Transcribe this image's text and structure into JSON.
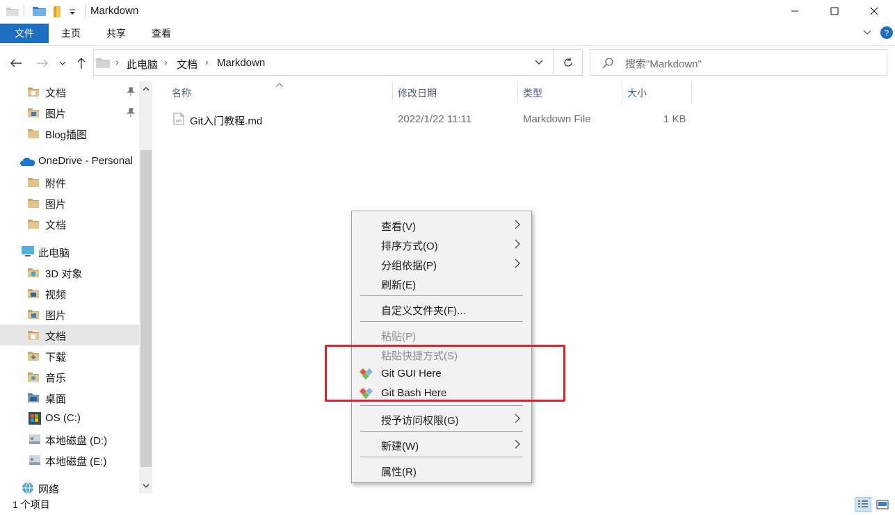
{
  "window": {
    "title": "Markdown"
  },
  "ribbon": {
    "tabs": [
      "文件",
      "主页",
      "共享",
      "查看"
    ]
  },
  "address": {
    "crumbs": [
      "此电脑",
      "文档",
      "Markdown"
    ],
    "search_placeholder": "搜索\"Markdown\""
  },
  "sidebar": {
    "items": [
      {
        "label": "文档",
        "pinned": true
      },
      {
        "label": "图片",
        "pinned": true
      },
      {
        "label": "Blog插图",
        "pinned": false
      },
      {
        "label": "OneDrive - Personal"
      },
      {
        "label": "附件"
      },
      {
        "label": "图片"
      },
      {
        "label": "文档"
      },
      {
        "label": "此电脑"
      },
      {
        "label": "3D 对象"
      },
      {
        "label": "视频"
      },
      {
        "label": "图片"
      },
      {
        "label": "文档"
      },
      {
        "label": "下载"
      },
      {
        "label": "音乐"
      },
      {
        "label": "桌面"
      },
      {
        "label": "OS (C:)"
      },
      {
        "label": "本地磁盘 (D:)"
      },
      {
        "label": "本地磁盘 (E:)"
      },
      {
        "label": "网络"
      }
    ],
    "selected_index": 11
  },
  "columns": {
    "name": "名称",
    "modified": "修改日期",
    "type": "类型",
    "size": "大小"
  },
  "files": [
    {
      "name": "Git入门教程.md",
      "modified": "2022/1/22 11:11",
      "type": "Markdown File",
      "size": "1 KB"
    }
  ],
  "context_menu": {
    "items": [
      {
        "label": "查看(V)",
        "submenu": true
      },
      {
        "label": "排序方式(O)",
        "submenu": true
      },
      {
        "label": "分组依据(P)",
        "submenu": true
      },
      {
        "label": "刷新(E)"
      },
      {
        "label": "自定义文件夹(F)..."
      },
      {
        "label": "粘贴(P)",
        "disabled": true
      },
      {
        "label": "粘贴快捷方式(S)",
        "disabled": true
      },
      {
        "label": "Git GUI Here",
        "icon": "git-icon"
      },
      {
        "label": "Git Bash Here",
        "icon": "git-icon"
      },
      {
        "label": "授予访问权限(G)",
        "submenu": true
      },
      {
        "label": "新建(W)",
        "submenu": true
      },
      {
        "label": "属性(R)"
      }
    ]
  },
  "status": {
    "item_count": "1 个项目"
  },
  "colors": {
    "accent": "#1e6fc0",
    "highlight_box": "#e0202a",
    "folder": "#dcb67a"
  }
}
